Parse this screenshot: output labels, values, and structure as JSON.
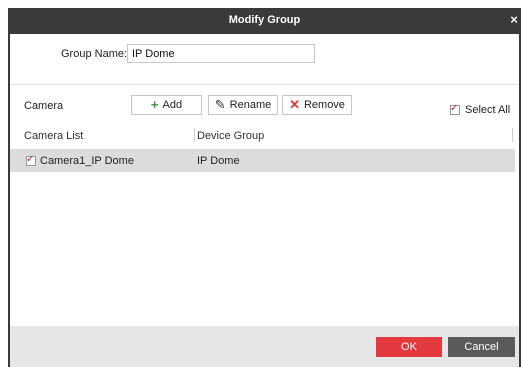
{
  "dialog": {
    "title": "Modify Group",
    "close_glyph": "×"
  },
  "group_name": {
    "label": "Group Name:",
    "value": "IP Dome"
  },
  "toolbar": {
    "section_label": "Camera",
    "add_label": "Add",
    "add_icon": "plus-icon",
    "rename_label": "Rename",
    "rename_icon": "pencil-icon",
    "remove_label": "Remove",
    "remove_icon": "x-icon",
    "select_all_label": "Select All",
    "select_all_checked": true
  },
  "table": {
    "headers": [
      "Camera List",
      "Device Group"
    ],
    "rows": [
      {
        "checked": true,
        "camera": "Camera1_IP Dome",
        "group": "IP Dome"
      }
    ]
  },
  "footer": {
    "ok_label": "OK",
    "cancel_label": "Cancel"
  },
  "colors": {
    "titlebar": "#3a3a3a",
    "ok_button": "#e33a3f",
    "cancel_button": "#5a5a5a",
    "check_mark": "#d21f2b",
    "selected_row": "#dcdcdc"
  }
}
